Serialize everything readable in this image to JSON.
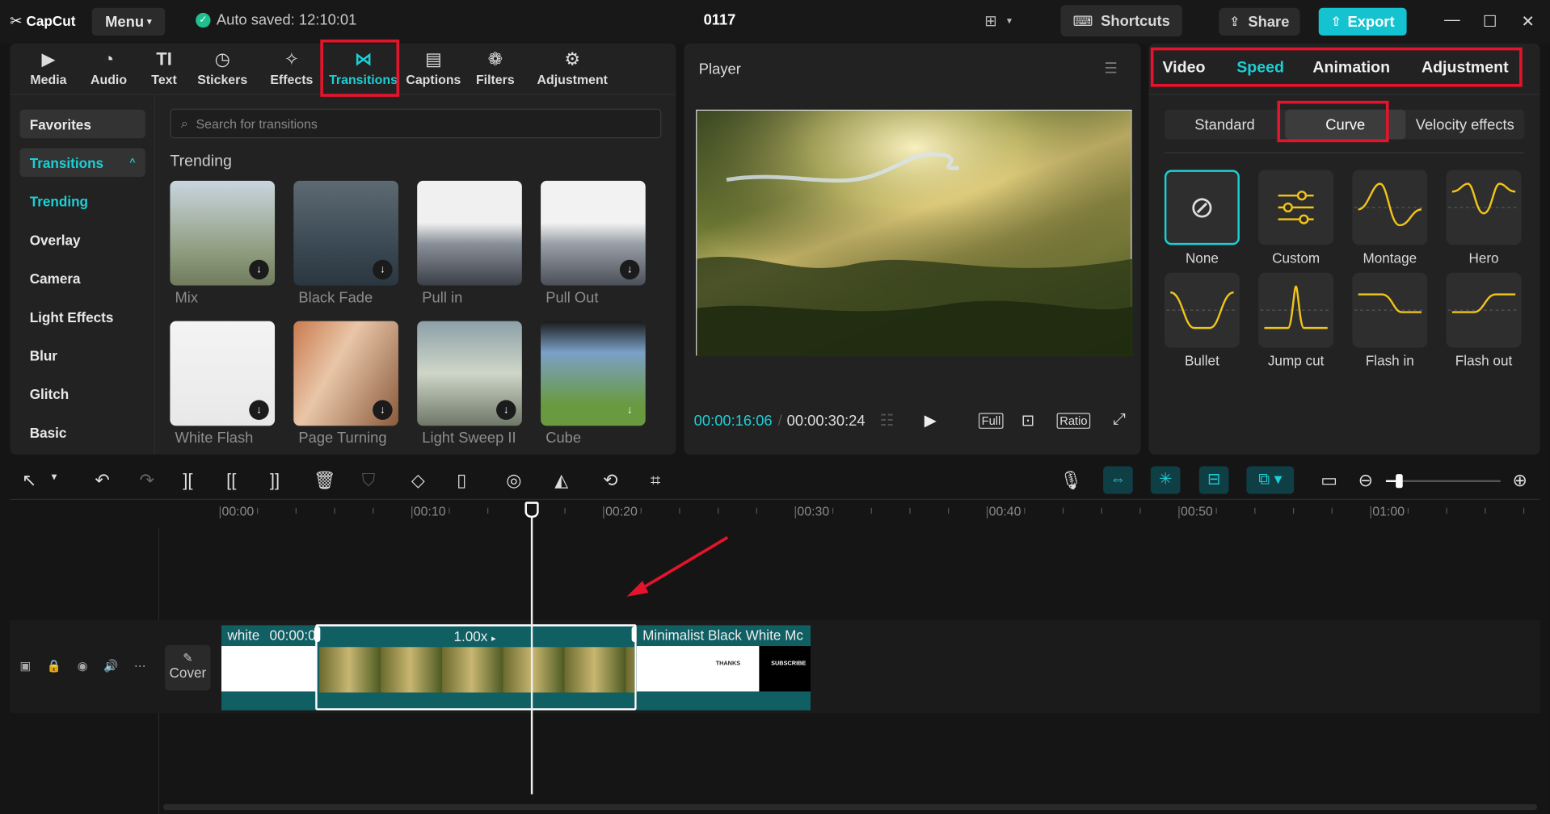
{
  "app": {
    "logo": "CapCut",
    "menu": "Menu",
    "autosave": "Auto saved: 12:10:01",
    "project": "0117",
    "shortcuts": "Shortcuts",
    "share": "Share",
    "export": "Export"
  },
  "toolbar": [
    {
      "label": "Media",
      "icon": "media-icon"
    },
    {
      "label": "Audio",
      "icon": "audio-icon"
    },
    {
      "label": "Text",
      "icon": "text-icon"
    },
    {
      "label": "Stickers",
      "icon": "stickers-icon"
    },
    {
      "label": "Effects",
      "icon": "effects-icon"
    },
    {
      "label": "Transitions",
      "icon": "transitions-icon",
      "active": true
    },
    {
      "label": "Captions",
      "icon": "captions-icon"
    },
    {
      "label": "Filters",
      "icon": "filters-icon"
    },
    {
      "label": "Adjustment",
      "icon": "adjustment-icon"
    }
  ],
  "sidebar": {
    "favorites": "Favorites",
    "transitions": "Transitions",
    "items": [
      "Trending",
      "Overlay",
      "Camera",
      "Light Effects",
      "Blur",
      "Glitch",
      "Basic"
    ]
  },
  "search": {
    "placeholder": "Search for transitions"
  },
  "trending_title": "Trending",
  "transitions": [
    "Mix",
    "Black Fade",
    "Pull in",
    "Pull Out",
    "White Flash",
    "Page Turning",
    "Light Sweep II",
    "Cube"
  ],
  "player": {
    "title": "Player",
    "current": "00:00:16:06",
    "total": "00:00:30:24",
    "full": "Full",
    "ratio": "Ratio"
  },
  "right_tabs": [
    "Video",
    "Speed",
    "Animation",
    "Adjustment"
  ],
  "speed_tabs": [
    "Standard",
    "Curve",
    "Velocity effects"
  ],
  "curves": [
    "None",
    "Custom",
    "Montage",
    "Hero",
    "Bullet",
    "Jump cut",
    "Flash in",
    "Flash out"
  ],
  "timeline": {
    "ticks": [
      "00:00",
      "00:10",
      "00:20",
      "00:30",
      "00:40",
      "00:50",
      "01:00"
    ],
    "cover": "Cover",
    "clip1_name": "white",
    "clip1_time": "00:00:0",
    "clip2_speed": "1.00x",
    "clip3_name": "Minimalist Black White Mc",
    "thanks": "THANKS",
    "subscribe": "SUBSCRIBE"
  },
  "colors": {
    "accent": "#1ccfd6",
    "highlight": "#e3142b",
    "bg": "#151515",
    "panel": "#222222",
    "clip": "#0f5f63"
  }
}
